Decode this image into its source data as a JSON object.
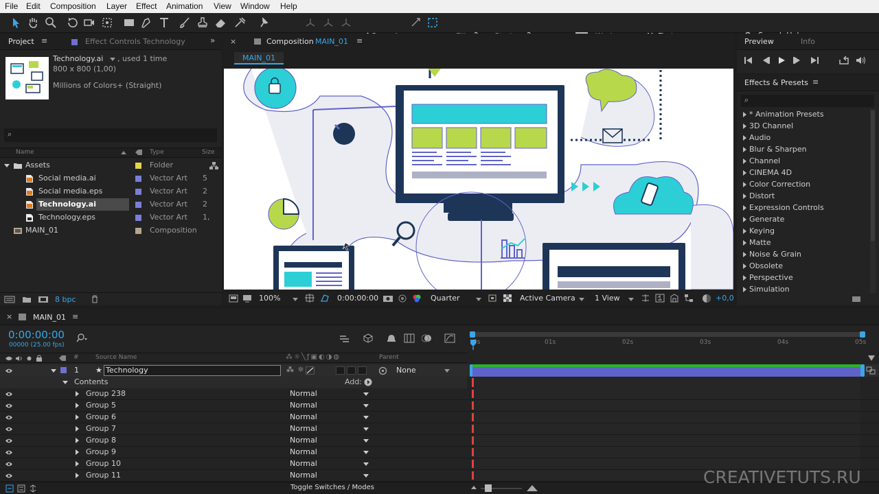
{
  "menu": [
    "File",
    "Edit",
    "Composition",
    "Layer",
    "Effect",
    "Animation",
    "View",
    "Window",
    "Help"
  ],
  "toolbar": {
    "snapping": "Snapping",
    "fill": "Fill:",
    "fill_val": "?",
    "stroke": "Stroke:",
    "stroke_val": "?",
    "workspace_label": "Workspace:",
    "workspace": "MyFirst",
    "search": "Search Help"
  },
  "project": {
    "tab": "Project",
    "effect_tab": "Effect Controls Technology",
    "file_name": "Technology.ai",
    "used": ", used 1 time",
    "dims": "800 x 800 (1,00)",
    "colors": "Millions of Colors+ (Straight)",
    "search_placeholder": "⌕",
    "col_name": "Name",
    "col_type": "Type",
    "col_size": "Size",
    "bpc": "8 bpc",
    "items": [
      {
        "name": "Assets",
        "type": "Folder",
        "size": "",
        "color": "#e6d34a",
        "indent": 0,
        "kind": "folder"
      },
      {
        "name": "Social media.ai",
        "type": "Vector Art",
        "size": "5",
        "color": "#7a7fd6",
        "indent": 1,
        "kind": "ai"
      },
      {
        "name": "Social media.eps",
        "type": "Vector Art",
        "size": "2",
        "color": "#7a7fd6",
        "indent": 1,
        "kind": "ai"
      },
      {
        "name": "Technology.ai",
        "type": "Vector Art",
        "size": "2",
        "color": "#7a7fd6",
        "indent": 1,
        "kind": "ai",
        "selected": true
      },
      {
        "name": "Technology.eps",
        "type": "Vector Art",
        "size": "1,",
        "color": "#7a7fd6",
        "indent": 1,
        "kind": "eps"
      },
      {
        "name": "MAIN_01",
        "type": "Composition",
        "size": "",
        "color": "#b5a58a",
        "indent": 0,
        "kind": "comp"
      }
    ]
  },
  "comp": {
    "tab_prefix": "Composition",
    "tab_name": "MAIN_01",
    "subtab": "MAIN_01",
    "zoom": "100%",
    "time": "0:00:00:00",
    "res": "Quarter",
    "camera": "Active Camera",
    "view": "1 View",
    "offset": "+0,0"
  },
  "preview": {
    "tab": "Preview",
    "info_tab": "Info"
  },
  "effects": {
    "title": "Effects & Presets",
    "search": "⌕",
    "items": [
      "* Animation Presets",
      "3D Channel",
      "Audio",
      "Blur & Sharpen",
      "Channel",
      "CINEMA 4D",
      "Color Correction",
      "Distort",
      "Expression Controls",
      "Generate",
      "Keying",
      "Matte",
      "Noise & Grain",
      "Obsolete",
      "Perspective",
      "Simulation"
    ]
  },
  "timeline": {
    "tab": "MAIN_01",
    "timecode": "0:00:00:00",
    "fps": "00000 (25.00 fps)",
    "col_source": "Source Name",
    "col_parent": "Parent",
    "layer_num": "1",
    "layer_name": "Technology",
    "parent_val": "None",
    "contents": "Contents",
    "add": "Add:",
    "toggle": "Toggle Switches / Modes",
    "ruler": [
      "0s",
      "01s",
      "02s",
      "03s",
      "04s",
      "05s"
    ],
    "groups": [
      {
        "name": "Group 238",
        "mode": "Normal"
      },
      {
        "name": "Group 5",
        "mode": "Normal"
      },
      {
        "name": "Group 6",
        "mode": "Normal"
      },
      {
        "name": "Group 7",
        "mode": "Normal"
      },
      {
        "name": "Group 8",
        "mode": "Normal"
      },
      {
        "name": "Group 9",
        "mode": "Normal"
      },
      {
        "name": "Group 10",
        "mode": "Normal"
      },
      {
        "name": "Group 11",
        "mode": "Normal"
      }
    ]
  },
  "watermark": "CREATIVETUTS.RU",
  "colors": {
    "accent": "#3aa6e8",
    "layer_bar": "#5f63c9",
    "work_area": "#2bb32b",
    "selection": "#4a4a4a"
  }
}
